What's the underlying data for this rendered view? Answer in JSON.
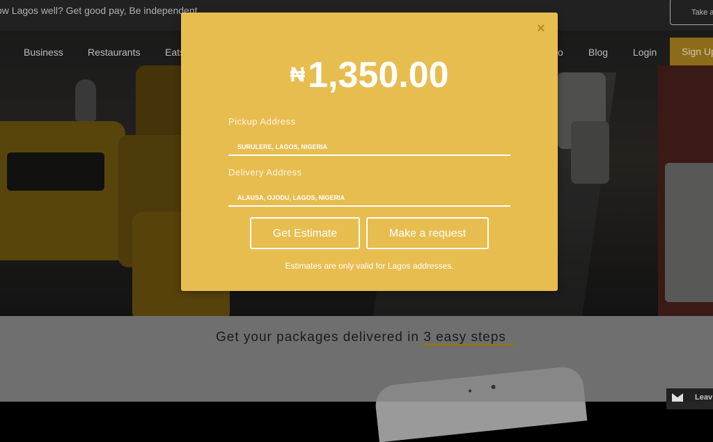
{
  "topbar": {
    "message": "ow Lagos well? Get good pay, Be independent",
    "take_button": "Take a"
  },
  "nav": {
    "items": [
      "Business",
      "Restaurants",
      "Eats",
      "o",
      "Blog",
      "Login"
    ],
    "signup": "Sign Up"
  },
  "modal": {
    "close": "×",
    "currency": "₦",
    "price": "1,350.00",
    "pickup_label": "Pickup Address",
    "pickup_value": "SURULERE, LAGOS, NIGERIA",
    "delivery_label": "Delivery Address",
    "delivery_value": "ALAUSA, OJODU, LAGOS, NIGERIA",
    "estimate_button": "Get Estimate",
    "request_button": "Make a request",
    "note": "Estimates are only valid for Lagos addresses."
  },
  "section": {
    "heading_prefix": "Get your packages delivered in ",
    "heading_highlight": "3 easy steps"
  },
  "chat": {
    "label": "Leav",
    "icon": "mail-icon"
  },
  "colors": {
    "modal_bg": "#e8bd4f",
    "accent": "#a38324",
    "signup_bg": "#a07c1e"
  }
}
